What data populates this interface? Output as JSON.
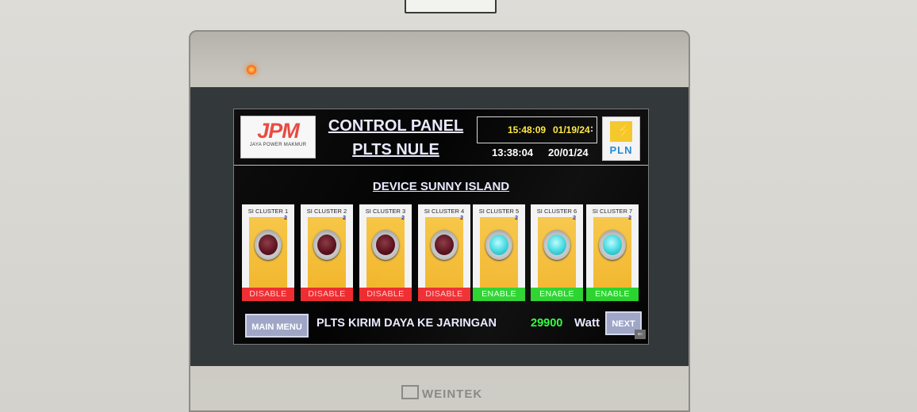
{
  "header": {
    "jpm_logo_mark": "JPM",
    "jpm_logo_text": "JAYA POWER MAKMUR",
    "title_line1": "CONTROL PANEL",
    "title_line2": "PLTS NULE",
    "clock_time": "15:48:09",
    "clock_date": "01/19/24",
    "clock_sep": ":",
    "time2": "13:38:04",
    "date2": "20/01/24",
    "pln_logo_text": "PLN"
  },
  "main": {
    "subtitle": "DEVICE SUNNY ISLAND",
    "clusters": [
      {
        "label": "SI CLUSTER 1",
        "sn": "2",
        "status": "DISABLE",
        "state": "off"
      },
      {
        "label": "SI CLUSTER 2",
        "sn": "2",
        "status": "DISABLE",
        "state": "off"
      },
      {
        "label": "SI CLUSTER 3",
        "sn": "2",
        "status": "DISABLE",
        "state": "off"
      },
      {
        "label": "SI CLUSTER 4",
        "sn": "2",
        "status": "DISABLE",
        "state": "off"
      },
      {
        "label": "SI CLUSTER 5",
        "sn": "2",
        "status": "ENABLE",
        "state": "on"
      },
      {
        "label": "SI CLUSTER 6",
        "sn": "2",
        "status": "ENABLE",
        "state": "on"
      },
      {
        "label": "SI CLUSTER 7",
        "sn": "2",
        "status": "ENABLE",
        "state": "on"
      }
    ]
  },
  "footer": {
    "main_menu_label": "MAIN MENU",
    "info_text": "PLTS KIRIM DAYA KE JARINGAN",
    "power_value": "29900",
    "power_unit": "Watt",
    "next_label": "NEXT"
  },
  "device": {
    "brand": "WEINTEK"
  },
  "colors": {
    "disable": "#ee2c30",
    "enable": "#27d32b",
    "lamp_off": "#5a0f1c",
    "lamp_on": "#38d6dc",
    "power_value": "#2cff3c",
    "clock_text": "#ffe93c"
  }
}
